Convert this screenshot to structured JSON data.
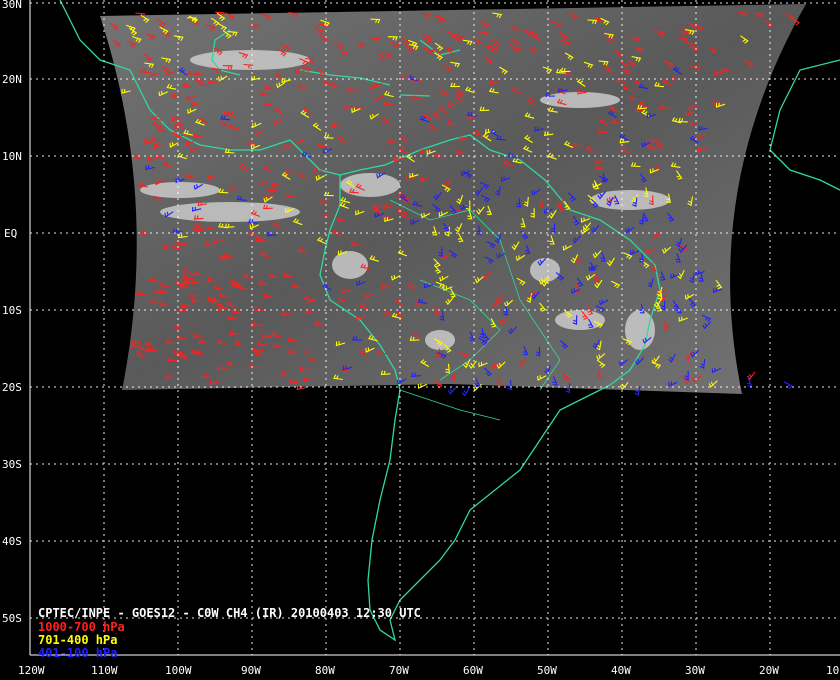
{
  "map": {
    "lat_labels": [
      "30N",
      "20N",
      "10N",
      "EQ",
      "10S",
      "20S",
      "30S",
      "40S",
      "50S"
    ],
    "lon_labels": [
      "120W",
      "110W",
      "100W",
      "90W",
      "80W",
      "70W",
      "60W",
      "50W",
      "40W",
      "30W",
      "20W",
      "10"
    ],
    "grid": "dotted",
    "credit": "CPTEC/INPE - GOES12 - C0W CH4 (IR) 20100403 12:30 UTC",
    "legend": [
      {
        "label": "1000-700 hPa",
        "color": "#ff2020"
      },
      {
        "label": "701-400 hPa",
        "color": "#ffff00"
      },
      {
        "label": "401-100 hPa",
        "color": "#2020ff"
      }
    ],
    "colors": {
      "background": "#000000",
      "coastline": "#2fd9a0",
      "grid": "#ffffff",
      "satellite_ir": "#6e6e6e"
    }
  }
}
